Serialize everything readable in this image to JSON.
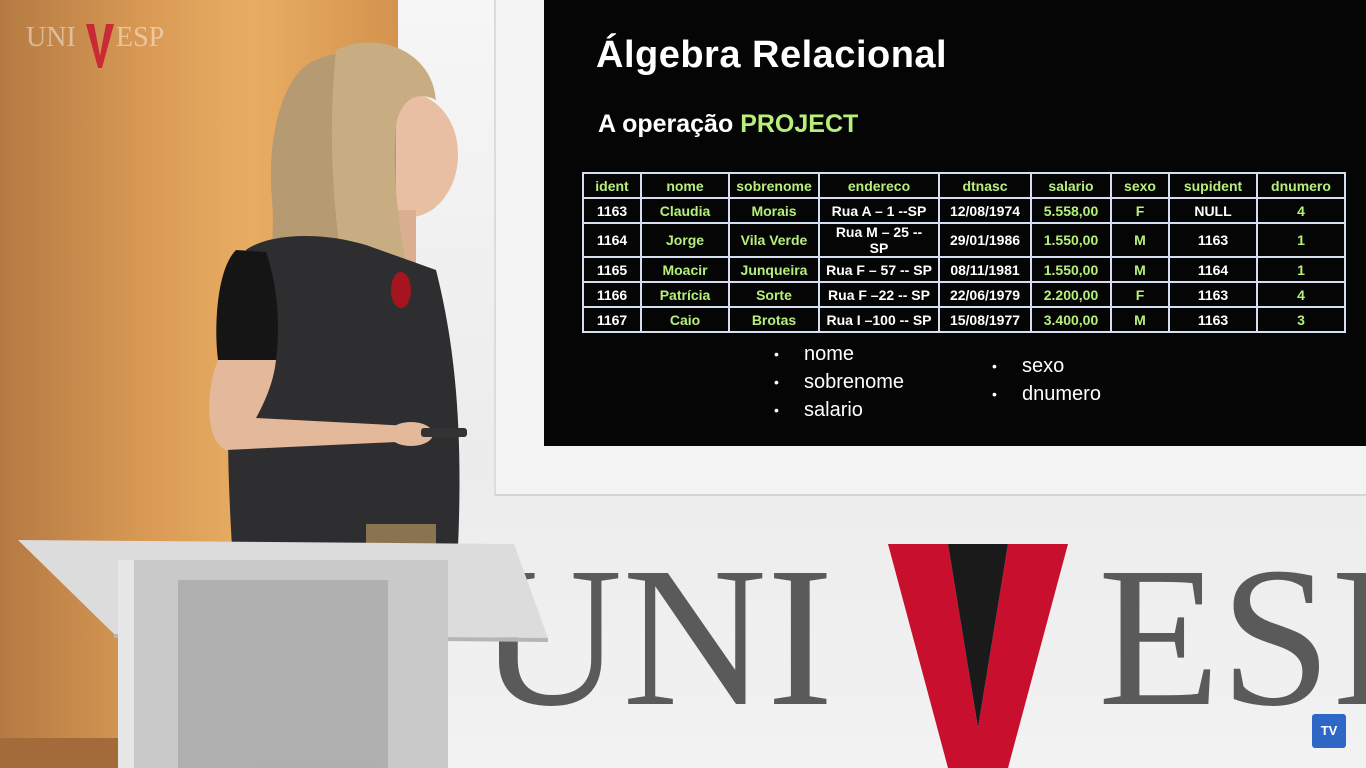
{
  "corner_logo": {
    "text": "UNIVESP"
  },
  "wall_logo": {
    "letters_left": "UNI",
    "letters_right": "ESP"
  },
  "slide": {
    "title": "Álgebra Relacional",
    "subtitle_prefix": "A operação ",
    "subtitle_highlight": "PROJECT",
    "table": {
      "columns": [
        "ident",
        "nome",
        "sobrenome",
        "endereco",
        "dtnasc",
        "salario",
        "sexo",
        "supident",
        "dnumero"
      ],
      "rows": [
        [
          "1163",
          "Claudia",
          "Morais",
          "Rua A – 1 --SP",
          "12/08/1974",
          "5.558,00",
          "F",
          "NULL",
          "4"
        ],
        [
          "1164",
          "Jorge",
          "Vila Verde",
          "Rua M – 25 -- SP",
          "29/01/1986",
          "1.550,00",
          "M",
          "1163",
          "1"
        ],
        [
          "1165",
          "Moacir",
          "Junqueira",
          "Rua F – 57 -- SP",
          "08/11/1981",
          "1.550,00",
          "M",
          "1164",
          "1"
        ],
        [
          "1166",
          "Patrícia",
          "Sorte",
          "Rua F –22 -- SP",
          "22/06/1979",
          "2.200,00",
          "F",
          "1163",
          "4"
        ],
        [
          "1167",
          "Caio",
          "Brotas",
          "Rua I –100 -- SP",
          "15/08/1977",
          "3.400,00",
          "M",
          "1163",
          "3"
        ]
      ]
    },
    "bullets_left": [
      "nome",
      "sobrenome",
      "salario"
    ],
    "bullets_right": [
      "sexo",
      "dnumero"
    ],
    "bullet_glyph": "•"
  },
  "tv_badge": {
    "label": "TV"
  },
  "colors": {
    "slide_bg": "#050505",
    "highlight_green": "#b6f07a",
    "logo_red": "#c8102e",
    "logo_gray": "#5a5a5a"
  }
}
